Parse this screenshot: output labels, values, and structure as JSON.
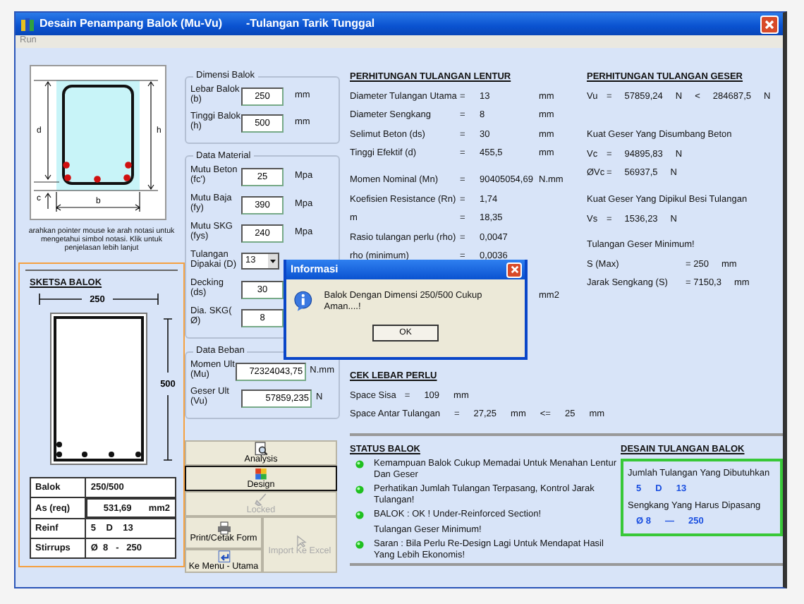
{
  "window": {
    "title": "Desain Penampang Balok (Mu-Vu)",
    "subtitle": "-Tulangan Tarik Tunggal"
  },
  "menu": [
    "Run"
  ],
  "diagram": {
    "labels": [
      "d",
      "h",
      "c",
      "b"
    ],
    "caption": "arahkan pointer mouse ke arah notasi untuk mengetahui simbol notasi. Klik untuk penjelasan lebih lanjut"
  },
  "sketch": {
    "title": "SKETSA BALOK",
    "width_label": "250",
    "height_label": "500",
    "table": [
      {
        "label": "Balok",
        "value": "250/500"
      },
      {
        "label": "As (req)",
        "value": "531,69",
        "unit": "mm2"
      },
      {
        "label": "Reinf",
        "value": "5    D    13"
      },
      {
        "label": "Stirrups",
        "value": "Ø  8   -   250"
      }
    ]
  },
  "groups": [
    {
      "title": "Dimensi Balok",
      "fields": [
        {
          "kind": "input",
          "label": "Lebar Balok (b)",
          "value": "250",
          "unit": "mm"
        },
        {
          "kind": "input",
          "label": "Tinggi Balok (h)",
          "value": "500",
          "unit": "mm"
        }
      ]
    },
    {
      "title": "Data Material",
      "fields": [
        {
          "kind": "input",
          "label": "Mutu Beton (fc')",
          "value": "25",
          "unit": "Mpa"
        },
        {
          "kind": "input",
          "label": "Mutu Baja (fy)",
          "value": "390",
          "unit": "Mpa"
        },
        {
          "kind": "input",
          "label": "Mutu SKG (fys)",
          "value": "240",
          "unit": "Mpa"
        },
        {
          "kind": "select",
          "label": "Tulangan Dipakai (D)",
          "value": "13"
        },
        {
          "kind": "input",
          "label": "Decking (ds)",
          "value": "30"
        },
        {
          "kind": "input",
          "label": "Dia. SKG( Ø)",
          "value": "8"
        }
      ]
    },
    {
      "title": "Data Beban",
      "fields": [
        {
          "kind": "wide",
          "label": "Momen Ult (Mu)",
          "value": "72324043,75",
          "unit": "N.mm"
        },
        {
          "kind": "wide",
          "label": "Geser Ult (Vu)",
          "value": "57859,235",
          "unit": "N"
        }
      ]
    }
  ],
  "buttons": [
    {
      "label": "Analysis",
      "disabled": false,
      "focused": false
    },
    {
      "label": "Design",
      "disabled": false,
      "focused": true
    },
    {
      "label": "Locked",
      "disabled": true,
      "focused": false
    },
    {
      "label": "Print/Cetak Form",
      "disabled": false,
      "focused": false
    },
    {
      "label": "Import Ke Excel",
      "disabled": true,
      "focused": false
    },
    {
      "label": "Ke Menu - Utama",
      "disabled": false,
      "focused": false
    }
  ],
  "lentur": {
    "title": "PERHITUNGAN TULANGAN LENTUR",
    "sections": [
      [
        {
          "label": "Diameter Tulangan Utama",
          "eq": "=",
          "value": "13",
          "unit": "mm"
        },
        {
          "label": "Diameter Sengkang",
          "eq": "=",
          "value": "8",
          "unit": "mm"
        },
        {
          "label": "Selimut Beton (ds)",
          "eq": "=",
          "value": "30",
          "unit": "mm"
        },
        {
          "label": "Tinggi Efektif (d)",
          "eq": "=",
          "value": "455,5",
          "unit": "mm"
        }
      ],
      [
        {
          "label": "Momen Nominal (Mn)",
          "eq": "=",
          "value": "90405054,69",
          "unit": "N.mm"
        },
        {
          "label": "Koefisien Resistance (Rn)",
          "eq": "=",
          "value": "1,74"
        },
        {
          "label": "m",
          "eq": "=",
          "value": "18,35"
        },
        {
          "label": "Rasio tulangan perlu (rho)",
          "eq": "=",
          "value": "0,0047"
        },
        {
          "label": "rho (minimum)",
          "eq": "=",
          "value": "0,0036"
        }
      ],
      [
        {
          "unit": "mm2"
        }
      ]
    ]
  },
  "geser": {
    "title": "PERHITUNGAN TULANGAN GESER",
    "sections": [
      [
        {
          "kind": "calc",
          "cells": [
            "Vu",
            "=",
            "57859,24",
            "N",
            "<",
            "284687,5",
            "N"
          ]
        }
      ],
      [
        {
          "kind": "note",
          "cells": [
            "Kuat Geser Yang Disumbang Beton"
          ]
        },
        {
          "kind": "calc",
          "cells": [
            "Vc",
            "=",
            "94895,83",
            "N"
          ]
        },
        {
          "kind": "calc",
          "cells": [
            "ØVc",
            "=",
            "56937,5",
            "N"
          ]
        }
      ],
      [
        {
          "kind": "note",
          "cells": [
            "Kuat Geser Yang Dipikul Besi Tulangan"
          ]
        },
        {
          "kind": "calc",
          "cells": [
            "Vs",
            "=",
            "1536,23",
            "N"
          ]
        }
      ],
      [
        {
          "kind": "note",
          "cells": [
            "Tulangan Geser Minimum!"
          ]
        },
        {
          "kind": "wide",
          "cells": [
            "S (Max)",
            "= 250",
            "mm"
          ]
        },
        {
          "kind": "wide",
          "cells": [
            "Jarak Sengkang (S)",
            "= 7150,3",
            "mm"
          ]
        }
      ]
    ]
  },
  "cek": {
    "title": "CEK LEBAR PERLU",
    "rows": [
      {
        "kind": "short",
        "label": "Space Sisa",
        "parts": [
          "=",
          "109",
          "mm"
        ]
      },
      {
        "kind": "long",
        "label": "Space Antar Tulangan",
        "parts": [
          "=",
          "27,25",
          "mm",
          "<=",
          "25",
          "mm"
        ]
      }
    ]
  },
  "status": {
    "title": "STATUS BALOK",
    "items": [
      {
        "text": "Kemampuan Balok Cukup Memadai Untuk Menahan Lentur Dan Geser"
      },
      {
        "text": "Perhatikan Jumlah Tulangan Terpasang, Kontrol Jarak Tulangan!"
      },
      {
        "text": "BALOK : OK !  Under-Reinforced Section!",
        "note": "Tulangan Geser Minimum!"
      },
      {
        "text": "Saran : Bila Perlu Re-Design Lagi Untuk Mendapat Hasil Yang Lebih Ekonomis!"
      }
    ]
  },
  "desain": {
    "title": "DESAIN TULANGAN BALOK",
    "lines": [
      {
        "kind": "label",
        "cells": [
          "Jumlah Tulangan Yang Dibutuhkan"
        ]
      },
      {
        "kind": "value",
        "cells": [
          "5",
          "D",
          "13"
        ]
      },
      {
        "kind": "label",
        "cells": [
          "Sengkang Yang Harus Dipasang"
        ]
      },
      {
        "kind": "value",
        "cells": [
          "Ø 8",
          "—",
          "250"
        ]
      }
    ]
  },
  "dialog": {
    "title": "Informasi",
    "message": "Balok Dengan Dimensi 250/500 Cukup Aman....!",
    "button": "OK"
  }
}
